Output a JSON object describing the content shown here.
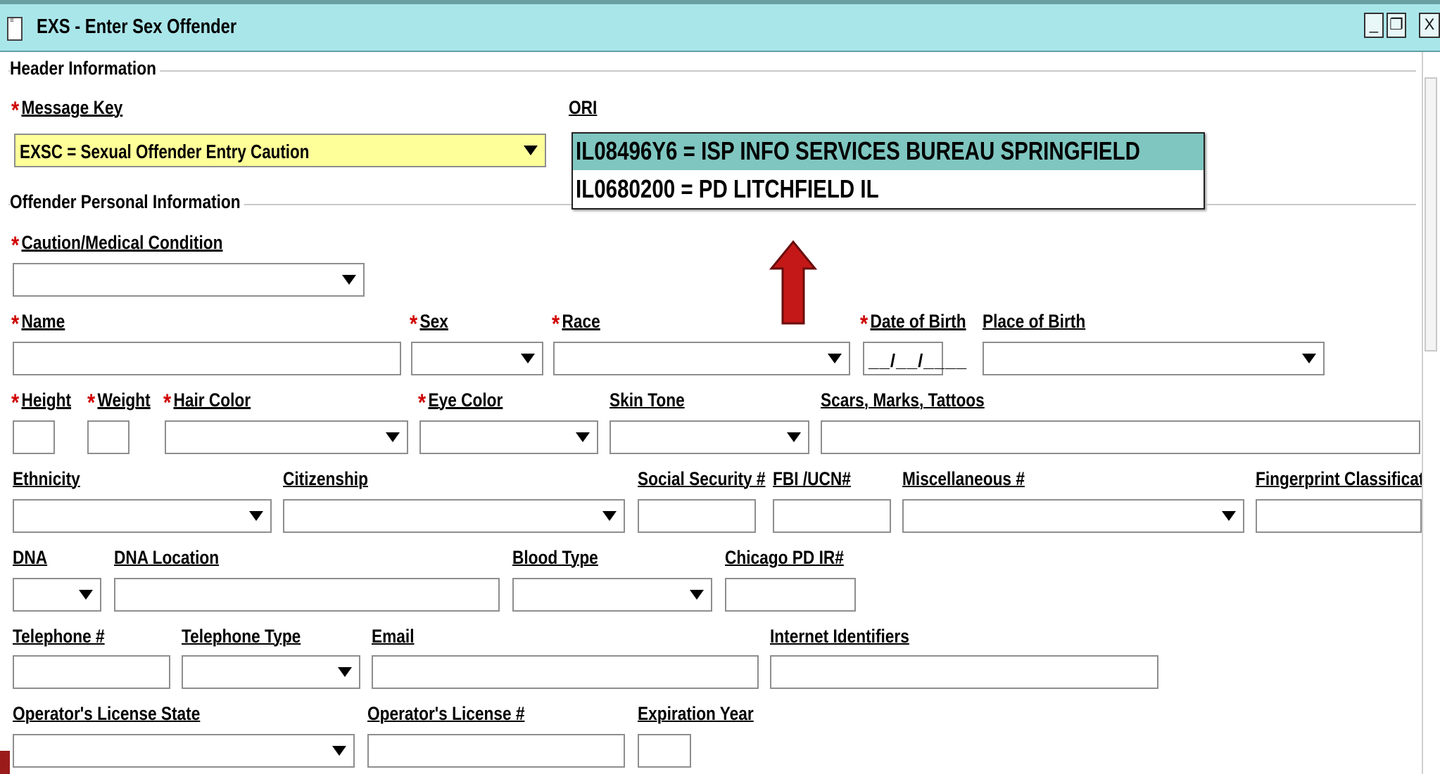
{
  "window": {
    "title": "EXS - Enter Sex Offender",
    "controls": {
      "minimize": "_",
      "restore": "❐",
      "close": "X"
    }
  },
  "header_section": {
    "label": "Header Information",
    "message_key": {
      "label": "Message Key",
      "required": "*",
      "value": "EXSC = Sexual Offender Entry Caution"
    },
    "ori": {
      "label": "ORI",
      "options": [
        "IL08496Y6 = ISP INFO SERVICES BUREAU SPRINGFIELD",
        "IL0680200 = PD LITCHFIELD IL"
      ],
      "highlighted_index": 0
    }
  },
  "personal_section": {
    "label": "Offender Personal Information",
    "required_marker": "*",
    "caution": {
      "label": "Caution/Medical Condition"
    },
    "name": {
      "label": "Name"
    },
    "sex": {
      "label": "Sex"
    },
    "race": {
      "label": "Race"
    },
    "dob": {
      "label": "Date of Birth",
      "mask": "__/__/____"
    },
    "place_of_birth": {
      "label": "Place of Birth"
    },
    "height": {
      "label": "Height"
    },
    "weight": {
      "label": "Weight"
    },
    "hair_color": {
      "label": "Hair Color"
    },
    "eye_color": {
      "label": "Eye Color"
    },
    "skin_tone": {
      "label": "Skin Tone"
    },
    "scars": {
      "label": "Scars, Marks, Tattoos"
    },
    "ethnicity": {
      "label": "Ethnicity"
    },
    "citizenship": {
      "label": "Citizenship"
    },
    "ssn": {
      "label": "Social Security #"
    },
    "fbi": {
      "label": "FBI /UCN#"
    },
    "misc": {
      "label": "Miscellaneous #"
    },
    "fingerprint": {
      "label": "Fingerprint Classificat"
    },
    "dna": {
      "label": "DNA"
    },
    "dna_location": {
      "label": "DNA Location"
    },
    "blood_type": {
      "label": "Blood Type"
    },
    "chicago_pd": {
      "label": "Chicago PD IR#"
    },
    "telephone": {
      "label": "Telephone #"
    },
    "telephone_type": {
      "label": "Telephone Type"
    },
    "email": {
      "label": "Email"
    },
    "internet_ids": {
      "label": "Internet Identifiers"
    },
    "ol_state": {
      "label": "Operator's License State"
    },
    "ol_number": {
      "label": "Operator's License #"
    },
    "expiration_year": {
      "label": "Expiration Year"
    }
  },
  "colors": {
    "title_bar": "#a9e6ea",
    "message_key_bg": "#ffff99",
    "ori_highlight": "#7fc6c0",
    "required": "#d00000",
    "arrow": "#c41818"
  },
  "annotation": {
    "icon": "up-arrow"
  }
}
